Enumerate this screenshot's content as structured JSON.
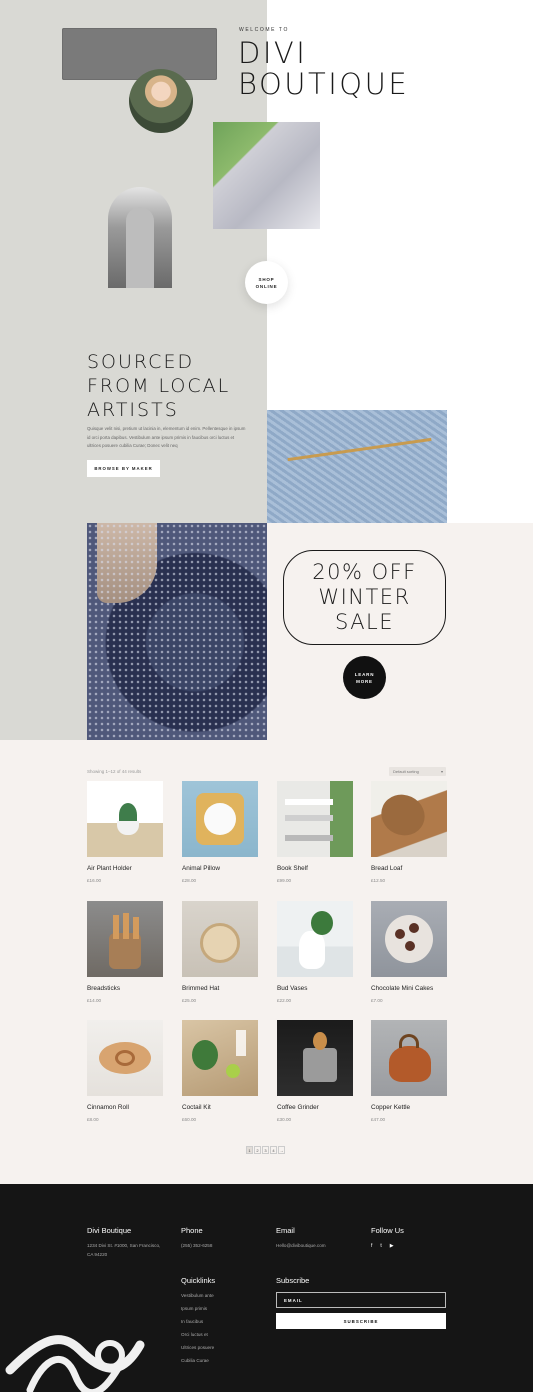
{
  "hero": {
    "welcome": "WELCOME TO",
    "title_line1": "DIVI",
    "title_line2": "BOUTIQUE",
    "shop_button_line1": "SHOP",
    "shop_button_line2": "ONLINE"
  },
  "sourced": {
    "title_line1": "SOURCED",
    "title_line2": "FROM LOCAL",
    "title_line3": "ARTISTS",
    "body": "Quisque velit nisi, pretium ut lacinia in, elementum id enim. Pellentesque in ipsum id orci porta dapibus. Vestibulum ante ipsum primis in faucibus orci luctus et ultrices posuere cubilia Curae; Donec velit neq",
    "button": "BROWSE BY MAKER"
  },
  "sale": {
    "line1": "20% OFF",
    "line2": "WINTER",
    "line3": "SALE",
    "button_line1": "LEARN",
    "button_line2": "MORE"
  },
  "shop": {
    "results": "Showing 1–12 of 44 results",
    "sort": "Default sorting",
    "products": [
      {
        "name": "Air Plant Holder",
        "price": "£16.00",
        "icon": "plant-holder-image"
      },
      {
        "name": "Animal Pillow",
        "price": "£28.00",
        "icon": "pillow-image"
      },
      {
        "name": "Book Shelf",
        "price": "£99.00",
        "icon": "shelf-image"
      },
      {
        "name": "Bread Loaf",
        "price": "£12.50",
        "icon": "bread-image"
      },
      {
        "name": "Breadsticks",
        "price": "£14.00",
        "icon": "breadsticks-image"
      },
      {
        "name": "Brimmed Hat",
        "price": "£25.00",
        "icon": "hat-image"
      },
      {
        "name": "Bud Vases",
        "price": "£22.00",
        "icon": "vases-image"
      },
      {
        "name": "Chocolate Mini Cakes",
        "price": "£7.00",
        "icon": "cakes-image"
      },
      {
        "name": "Cinnamon Roll",
        "price": "£8.00",
        "icon": "roll-image"
      },
      {
        "name": "Coctail Kit",
        "price": "£60.00",
        "icon": "cocktail-image"
      },
      {
        "name": "Coffee Grinder",
        "price": "£30.00",
        "icon": "grinder-image"
      },
      {
        "name": "Copper Kettle",
        "price": "£47.00",
        "icon": "kettle-image"
      }
    ],
    "pages": [
      "1",
      "2",
      "3",
      "4",
      "→"
    ]
  },
  "footer": {
    "brand": "Divi Boutique",
    "address": "1234 Divi St. #1000, San Francisco, CA 94220",
    "phone_title": "Phone",
    "phone": "(255) 352-6258",
    "email_title": "Email",
    "email": "Hello@diviboutique.com",
    "follow_title": "Follow Us",
    "social": [
      "f",
      "t",
      "▶"
    ],
    "quicklinks_title": "Quicklinks",
    "quicklinks": [
      "Vestibulum ante",
      "Ipsum primis",
      "In faucibus",
      "Orci luctus et",
      "Ultrices posuere",
      "Cubilia Curae"
    ],
    "subscribe_title": "Subscribe",
    "email_placeholder": "EMAIL",
    "subscribe_button": "SUBSCRIBE"
  },
  "colors": {
    "left_panel": "#d9d9d4",
    "cream": "#f6f2ef",
    "footer": "#151515"
  }
}
